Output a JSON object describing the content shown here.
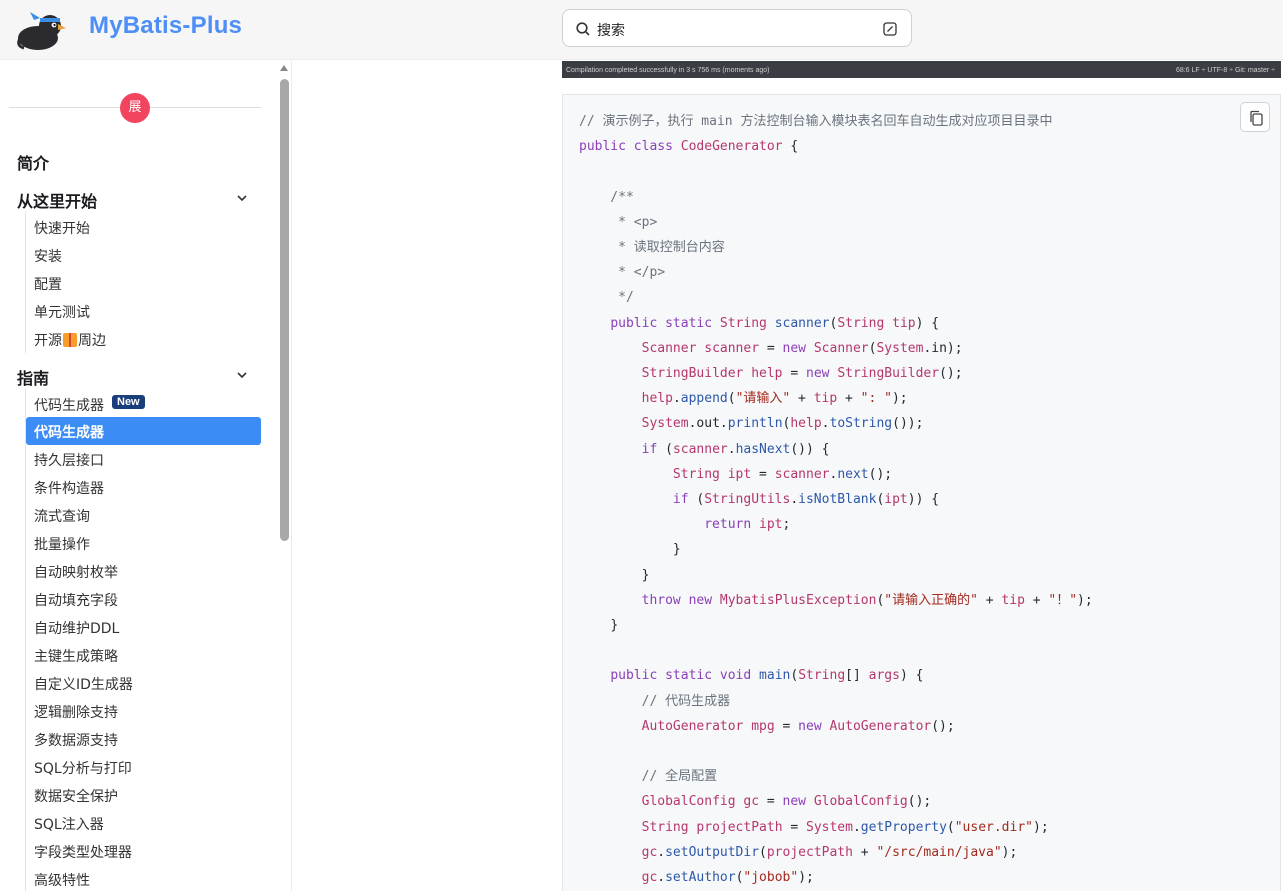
{
  "header": {
    "brand": "MyBatis-Plus",
    "search_placeholder": "搜索"
  },
  "sidebar": {
    "expand_label": "展",
    "sections": [
      {
        "label": "简介"
      },
      {
        "label": "从这里开始",
        "items": [
          "快速开始",
          "安装",
          "配置",
          "单元测试",
          "开源",
          "周边"
        ]
      },
      {
        "label": "指南",
        "items": [
          "代码生成器",
          "代码生成器",
          "持久层接口",
          "条件构造器",
          "流式查询",
          "批量操作",
          "自动映射枚举",
          "自动填充字段",
          "自动维护DDL",
          "主键生成策略",
          "自定义ID生成器",
          "逻辑删除支持",
          "多数据源支持",
          "SQL分析与打印",
          "数据安全保护",
          "SQL注入器",
          "字段类型处理器",
          "高级特性"
        ]
      }
    ],
    "new_badge": "New"
  },
  "strip": {
    "left_text": "Compilation completed successfully in 3 s 756 ms (moments ago)",
    "right_text": "68:6   LF ÷   UTF-8 ÷   Git: master ÷"
  },
  "code": {
    "lines": [
      "// 演示例子，执行 main 方法控制台输入模块表名回车自动生成对应项目目录中",
      "public class CodeGenerator {",
      "",
      "    /**",
      "     * <p>",
      "     * 读取控制台内容",
      "     * </p>",
      "     */",
      "    public static String scanner(String tip) {",
      "        Scanner scanner = new Scanner(System.in);",
      "        StringBuilder help = new StringBuilder();",
      "        help.append(\"请输入\" + tip + \": \");",
      "        System.out.println(help.toString());",
      "        if (scanner.hasNext()) {",
      "            String ipt = scanner.next();",
      "            if (StringUtils.isNotBlank(ipt)) {",
      "                return ipt;",
      "            }",
      "        }",
      "        throw new MybatisPlusException(\"请输入正确的\" + tip + \"！\");",
      "    }",
      "",
      "    public static void main(String[] args) {",
      "        // 代码生成器",
      "        AutoGenerator mpg = new AutoGenerator();",
      "",
      "        // 全局配置",
      "        GlobalConfig gc = new GlobalConfig();",
      "        String projectPath = System.getProperty(\"user.dir\");",
      "        gc.setOutputDir(projectPath + \"/src/main/java\");",
      "        gc.setAuthor(\"jobob\");"
    ]
  },
  "colors": {
    "brand": "#4e8ef7",
    "active": "#3c8cf5",
    "badge_red": "#f2445e",
    "new_badge": "#1a3d7c"
  }
}
